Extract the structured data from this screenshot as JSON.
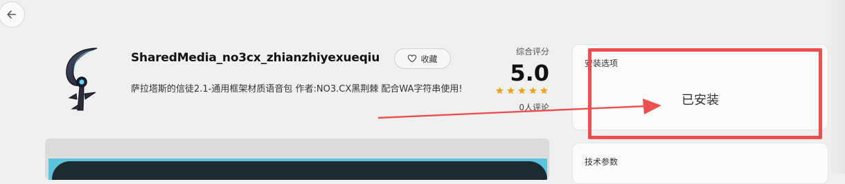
{
  "app": {
    "title": "SharedMedia_no3cx_zhianzhiyexueqiu",
    "favorite_label": "收藏",
    "description": "萨拉塔斯的信徒2.1-通用框架材质语音包 作者:NO3.CX黑荆棘 配合WA字符串使用!"
  },
  "rating": {
    "label": "综合评分",
    "score": "5.0",
    "stars": 5,
    "reviews": "0人评论"
  },
  "install": {
    "label": "安装选项",
    "status": "已安装"
  },
  "tech": {
    "label": "技术参数"
  },
  "colors": {
    "star": "#f2a21c",
    "highlight": "#ef4e4e",
    "preview_accent": "#5cc3dc"
  },
  "icons": {
    "back": "arrow-left-icon",
    "favorite": "heart-outline-icon",
    "star": "star-icon"
  }
}
